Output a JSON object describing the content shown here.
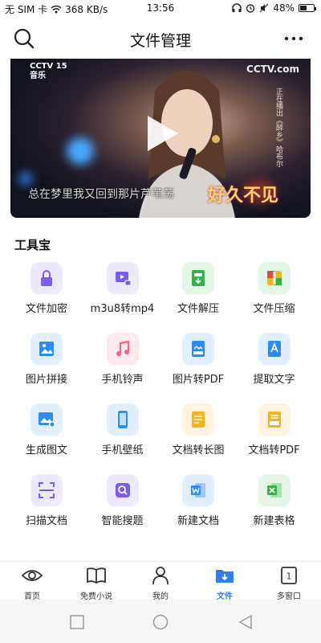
{
  "status_bar": {
    "carrier": "无 SIM 卡",
    "speed": "368 KB/s",
    "time": "13:56",
    "battery": "48%",
    "battery_level": 0.48
  },
  "header": {
    "title": "文件管理",
    "search_icon": "search-icon",
    "more_icon": "more-icon"
  },
  "video": {
    "channel_left": "CCTV 15",
    "channel_left_sub": "音乐",
    "channel_right": "CCTV.com",
    "caption": "总在梦里我又回到那片芦苇荡",
    "side_text": "正在播出《醉乡》哈布尔",
    "banner": "好久不见",
    "play_icon": "play-icon"
  },
  "tools": {
    "title": "工具宝",
    "items": [
      {
        "label": "文件加密",
        "icon": "lock-icon",
        "bg": "#eeeafd",
        "fg": "#7b5cf0"
      },
      {
        "label": "m3u8转mp4",
        "icon": "video-convert-icon",
        "bg": "#eeeafd",
        "fg": "#7b5cf0"
      },
      {
        "label": "文件解压",
        "icon": "unzip-icon",
        "bg": "#e4f6e6",
        "fg": "#35b04a"
      },
      {
        "label": "文件压缩",
        "icon": "compress-icon",
        "bg": "#e4f6e6",
        "fg": "#35b04a"
      },
      {
        "label": "图片拼接",
        "icon": "image-join-icon",
        "bg": "#e2f0fd",
        "fg": "#2d8cf0"
      },
      {
        "label": "手机铃声",
        "icon": "music-icon",
        "bg": "#fde9ee",
        "fg": "#f06388"
      },
      {
        "label": "图片转PDF",
        "icon": "image-pdf-icon",
        "bg": "#e2f0fd",
        "fg": "#2d8cf0"
      },
      {
        "label": "提取文字",
        "icon": "extract-text-icon",
        "bg": "#e2f0fd",
        "fg": "#2d8cf0"
      },
      {
        "label": "生成图文",
        "icon": "generate-image-icon",
        "bg": "#e2f0fd",
        "fg": "#2d8cf0"
      },
      {
        "label": "手机壁纸",
        "icon": "wallpaper-icon",
        "bg": "#e2f0fd",
        "fg": "#2d8cf0"
      },
      {
        "label": "文档转长图",
        "icon": "doc-long-image-icon",
        "bg": "#fdf3de",
        "fg": "#f2b51f"
      },
      {
        "label": "文档转PDF",
        "icon": "doc-pdf-icon",
        "bg": "#fdf3de",
        "fg": "#f2b51f"
      },
      {
        "label": "扫描文档",
        "icon": "scan-icon",
        "bg": "#eeeafd",
        "fg": "#7b5cf0"
      },
      {
        "label": "智能搜题",
        "icon": "search-question-icon",
        "bg": "#eeeafd",
        "fg": "#7b5cf0"
      },
      {
        "label": "新建文档",
        "icon": "word-icon",
        "bg": "#e2f0fd",
        "fg": "#2d8cf0"
      },
      {
        "label": "新建表格",
        "icon": "excel-icon",
        "bg": "#e4f6e6",
        "fg": "#35b04a"
      }
    ]
  },
  "tabbar": {
    "items": [
      {
        "label": "首页",
        "icon": "eye-icon",
        "active": false
      },
      {
        "label": "免费小说",
        "icon": "book-icon",
        "active": false
      },
      {
        "label": "我的",
        "icon": "user-icon",
        "active": false
      },
      {
        "label": "文件",
        "icon": "folder-icon",
        "active": true
      },
      {
        "label": "多窗口",
        "icon": "windows-icon",
        "active": false,
        "badge": "1"
      }
    ],
    "accent": "#2f80ed"
  },
  "navbar": {
    "recent_icon": "square-icon",
    "home_icon": "circle-icon",
    "back_icon": "triangle-back-icon"
  }
}
